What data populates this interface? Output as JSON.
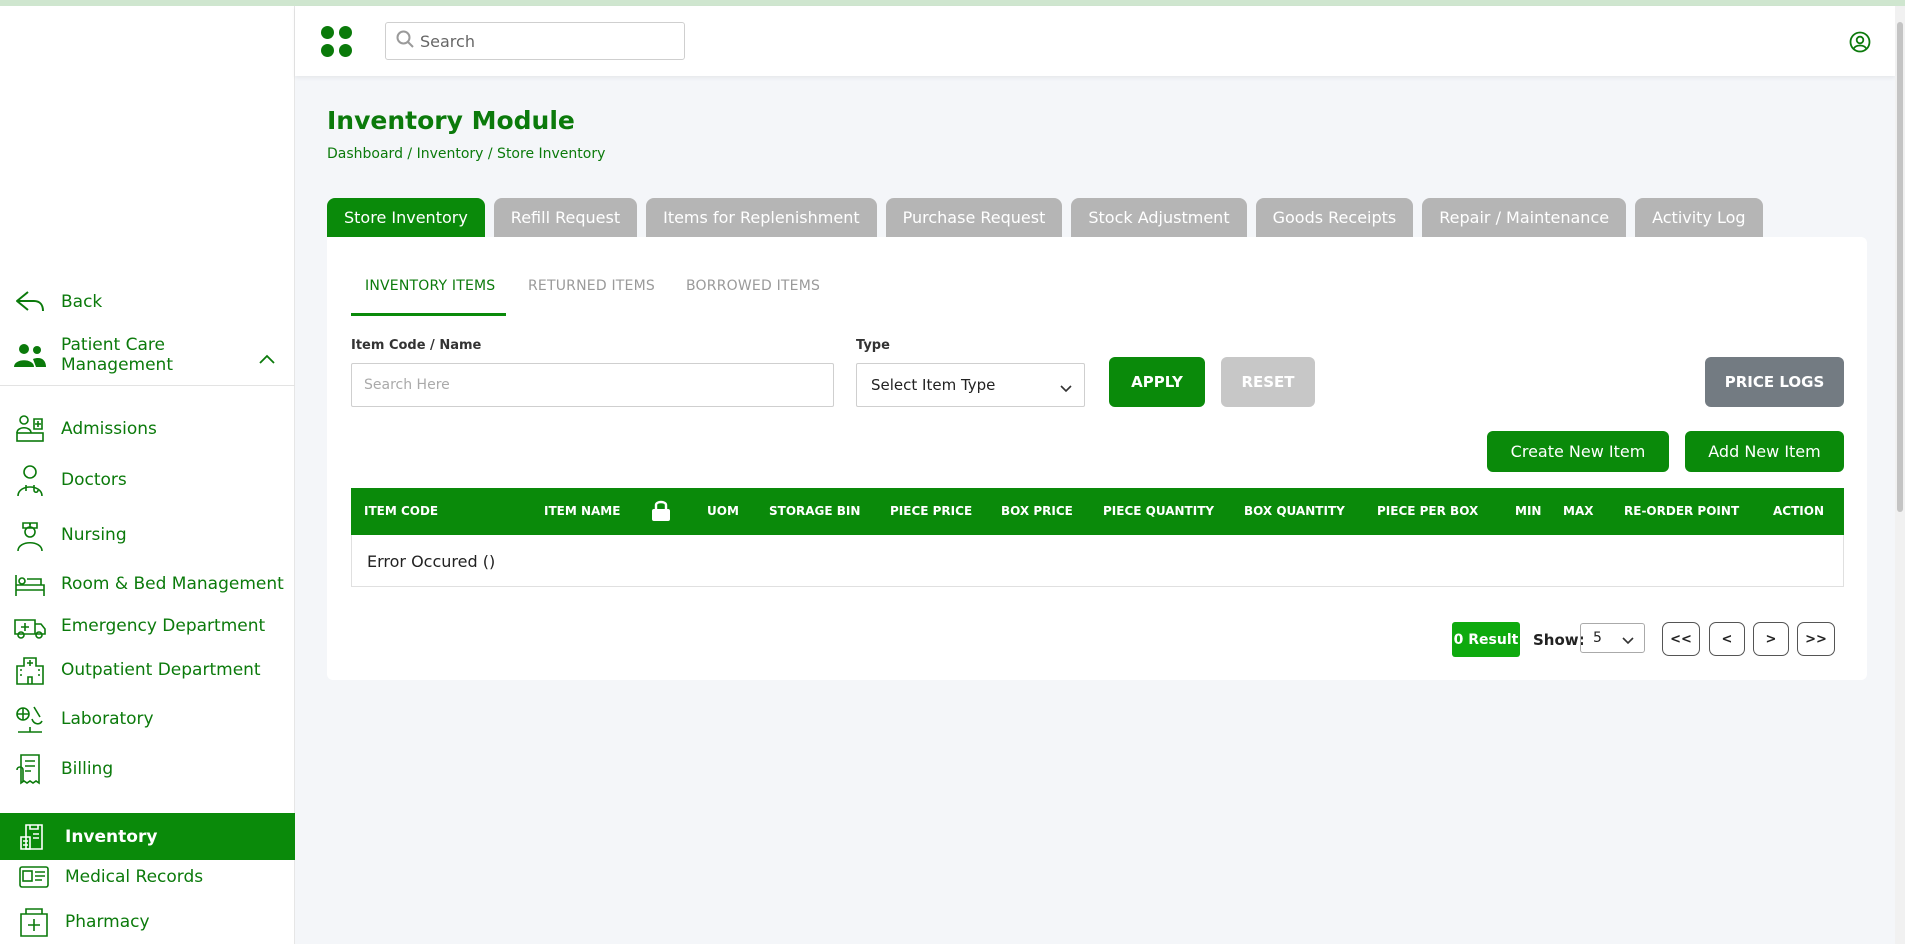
{
  "sidebar": {
    "back_label": "Back",
    "group_label": "Patient Care Management",
    "items": [
      {
        "label": "Admissions",
        "icon": "admissions-icon"
      },
      {
        "label": "Doctors",
        "icon": "doctor-icon"
      },
      {
        "label": "Nursing",
        "icon": "nurse-icon"
      },
      {
        "label": "Room & Bed Management",
        "icon": "bed-icon"
      },
      {
        "label": "Emergency Department",
        "icon": "ambulance-icon"
      },
      {
        "label": "Outpatient Department",
        "icon": "hospital-icon"
      },
      {
        "label": "Laboratory",
        "icon": "microscope-icon"
      },
      {
        "label": "Billing",
        "icon": "billing-icon"
      },
      {
        "label": "Inventory",
        "icon": "inventory-icon"
      },
      {
        "label": "Medical Records",
        "icon": "records-icon"
      },
      {
        "label": "Pharmacy",
        "icon": "pharmacy-icon"
      }
    ],
    "active_item": "Inventory"
  },
  "header": {
    "search_placeholder": "Search"
  },
  "page": {
    "title": "Inventory Module",
    "breadcrumb": "Dashboard / Inventory / Store Inventory"
  },
  "tabs": [
    {
      "label": "Store Inventory",
      "active": true
    },
    {
      "label": "Refill Request"
    },
    {
      "label": "Items for Replenishment"
    },
    {
      "label": "Purchase Request"
    },
    {
      "label": "Stock Adjustment"
    },
    {
      "label": "Goods Receipts"
    },
    {
      "label": "Repair / Maintenance"
    },
    {
      "label": "Activity Log"
    }
  ],
  "subtabs": [
    {
      "label": "INVENTORY ITEMS",
      "active": true
    },
    {
      "label": "RETURNED ITEMS"
    },
    {
      "label": "BORROWED ITEMS"
    }
  ],
  "filters": {
    "item_label": "Item Code / Name",
    "item_placeholder": "Search Here",
    "type_label": "Type",
    "type_value": "Select Item Type",
    "apply": "APPLY",
    "reset": "RESET",
    "price_logs": "PRICE LOGS"
  },
  "actions": {
    "create": "Create New Item",
    "add": "Add New Item"
  },
  "table": {
    "columns": [
      "ITEM CODE",
      "ITEM NAME",
      "",
      "UOM",
      "STORAGE BIN",
      "PIECE PRICE",
      "BOX PRICE",
      "PIECE QUANTITY",
      "BOX QUANTITY",
      "PIECE PER BOX",
      "MIN",
      "MAX",
      "RE-ORDER POINT",
      "ACTION"
    ],
    "message": "Error Occured ()"
  },
  "pagination": {
    "result": "0 Result",
    "show_label": "Show:",
    "show_value": "5",
    "first": "<<",
    "prev": "<",
    "next": ">",
    "last": ">>"
  },
  "colors": {
    "primary": "#0a8a0a",
    "text_green": "#0b7a0b",
    "tab_inactive": "#b5b5b5",
    "price_logs": "#737b82"
  }
}
